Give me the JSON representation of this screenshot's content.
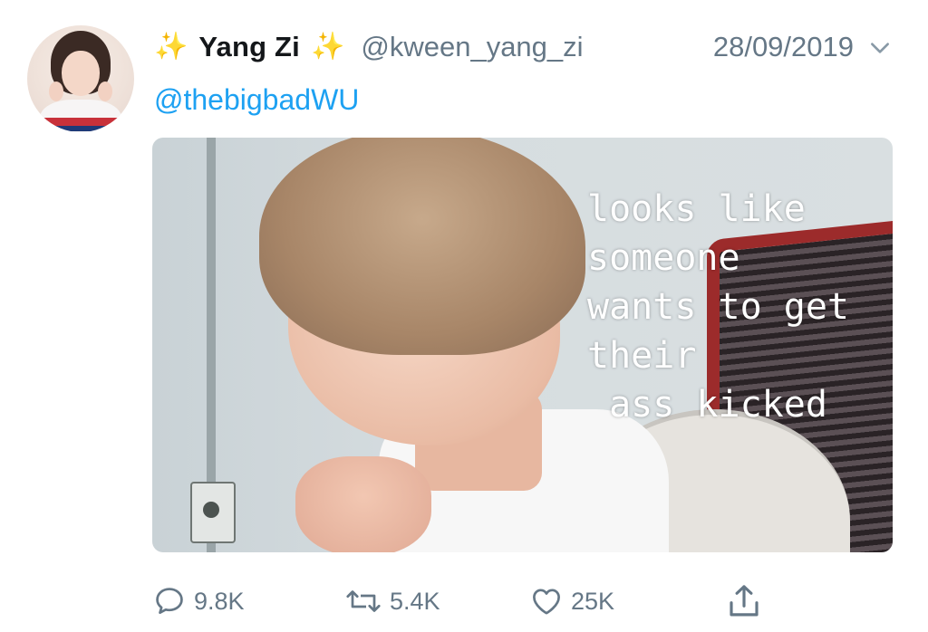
{
  "tweet": {
    "author_name": "Yang Zi",
    "name_decoration": "✨",
    "handle": "@kween_yang_zi",
    "date": "28/09/2019",
    "reply_to": "@thebigbadWU",
    "media": {
      "caption_lines": [
        "looks like",
        "someone",
        "wants to get",
        "their",
        " ass kicked"
      ]
    },
    "actions": {
      "replies": "9.8K",
      "retweets": "5.4K",
      "likes": "25K"
    }
  },
  "colors": {
    "link": "#1da1f2",
    "muted": "#657786",
    "text": "#14171a"
  },
  "icons": {
    "header": "chevron-down-icon",
    "reply": "speech-bubble-icon",
    "retweet": "retweet-arrows-icon",
    "like": "heart-icon",
    "share": "share-upload-icon"
  }
}
